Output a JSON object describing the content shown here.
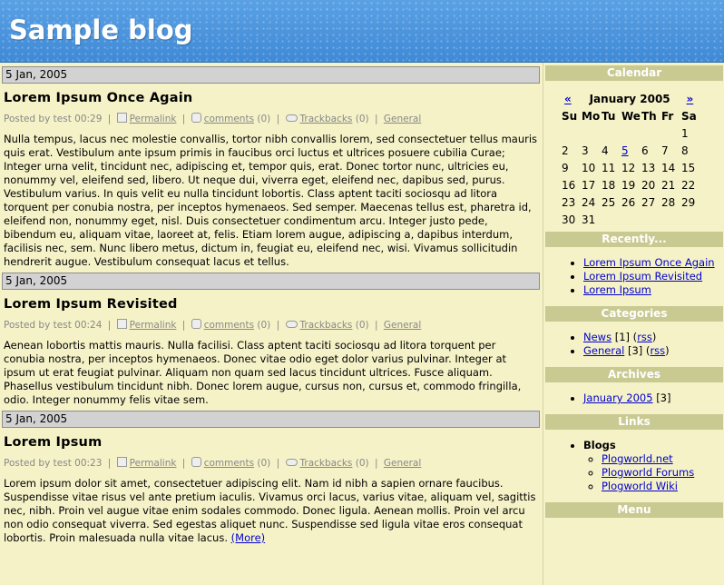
{
  "site": {
    "title": "Sample blog"
  },
  "posts": [
    {
      "date": "5 Jan, 2005",
      "title": "Lorem Ipsum Once Again",
      "meta": {
        "posted_by": "Posted by test 00:29",
        "permalink": "Permalink",
        "comments": "comments",
        "comments_count": "(0)",
        "trackbacks": "Trackbacks",
        "trackbacks_count": "(0)",
        "category": "General"
      },
      "body": "Nulla tempus, lacus nec molestie convallis, tortor nibh convallis lorem, sed consectetuer tellus mauris quis erat. Vestibulum ante ipsum primis in faucibus orci luctus et ultrices posuere cubilia Curae; Integer urna velit, tincidunt nec, adipiscing et, tempor quis, erat. Donec tortor nunc, ultricies eu, nonummy vel, eleifend sed, libero. Ut neque dui, viverra eget, eleifend nec, dapibus sed, purus. Vestibulum varius. In quis velit eu nulla tincidunt lobortis. Class aptent taciti sociosqu ad litora torquent per conubia nostra, per inceptos hymenaeos. Sed semper. Maecenas tellus est, pharetra id, eleifend non, nonummy eget, nisl. Duis consectetuer condimentum arcu. Integer justo pede, bibendum eu, aliquam vitae, laoreet at, felis. Etiam lorem augue, adipiscing a, dapibus interdum, facilisis nec, sem. Nunc libero metus, dictum in, feugiat eu, eleifend nec, wisi. Vivamus sollicitudin hendrerit augue. Vestibulum consequat lacus et tellus."
    },
    {
      "date": "5 Jan, 2005",
      "title": "Lorem Ipsum Revisited",
      "meta": {
        "posted_by": "Posted by test 00:24",
        "permalink": "Permalink",
        "comments": "comments",
        "comments_count": "(0)",
        "trackbacks": "Trackbacks",
        "trackbacks_count": "(0)",
        "category": "General"
      },
      "body": "Aenean lobortis mattis mauris. Nulla facilisi. Class aptent taciti sociosqu ad litora torquent per conubia nostra, per inceptos hymenaeos. Donec vitae odio eget dolor varius pulvinar. Integer at ipsum ut erat feugiat pulvinar. Aliquam non quam sed lacus tincidunt ultrices. Fusce aliquam. Phasellus vestibulum tincidunt nibh. Donec lorem augue, cursus non, cursus et, commodo fringilla, odio. Integer nonummy felis vitae sem."
    },
    {
      "date": "5 Jan, 2005",
      "title": "Lorem Ipsum",
      "meta": {
        "posted_by": "Posted by test 00:23",
        "permalink": "Permalink",
        "comments": "comments",
        "comments_count": "(0)",
        "trackbacks": "Trackbacks",
        "trackbacks_count": "(0)",
        "category": "General"
      },
      "body": "Lorem ipsum dolor sit amet, consectetuer adipiscing elit. Nam id nibh a sapien ornare faucibus. Suspendisse vitae risus vel ante pretium iaculis. Vivamus orci lacus, varius vitae, aliquam vel, sagittis nec, nibh. Proin vel augue vitae enim sodales commodo. Donec ligula. Aenean mollis. Proin vel arcu non odio consequat viverra. Sed egestas aliquet nunc. Suspendisse sed ligula vitae eros consequat lobortis. Proin malesuada nulla vitae lacus.",
      "more": "(More)"
    }
  ],
  "sidebar": {
    "calendar": {
      "title": "Calendar",
      "prev": "«",
      "next": "»",
      "month": "January 2005",
      "weekdays": [
        "Su",
        "Mo",
        "Tu",
        "We",
        "Th",
        "Fr",
        "Sa"
      ],
      "weeks": [
        [
          "",
          "",
          "",
          "",
          "",
          "",
          "1"
        ],
        [
          "2",
          "3",
          "4",
          "5",
          "6",
          "7",
          "8"
        ],
        [
          "9",
          "10",
          "11",
          "12",
          "13",
          "14",
          "15"
        ],
        [
          "16",
          "17",
          "18",
          "19",
          "20",
          "21",
          "22"
        ],
        [
          "23",
          "24",
          "25",
          "26",
          "27",
          "28",
          "29"
        ],
        [
          "30",
          "31",
          "",
          "",
          "",
          "",
          ""
        ]
      ],
      "linked_day": "5"
    },
    "recently": {
      "title": "Recently...",
      "items": [
        "Lorem Ipsum Once Again",
        "Lorem Ipsum Revisited",
        "Lorem Ipsum"
      ]
    },
    "categories": {
      "title": "Categories",
      "items": [
        {
          "name": "News",
          "count": "[1]",
          "rss": "rss"
        },
        {
          "name": "General",
          "count": "[3]",
          "rss": "rss"
        }
      ]
    },
    "archives": {
      "title": "Archives",
      "items": [
        {
          "name": "January 2005",
          "count": "[3]"
        }
      ]
    },
    "links": {
      "title": "Links",
      "group": "Blogs",
      "items": [
        "Plogworld.net",
        "Plogworld Forums",
        "Plogworld Wiki"
      ]
    },
    "menu": {
      "title": "Menu"
    }
  }
}
